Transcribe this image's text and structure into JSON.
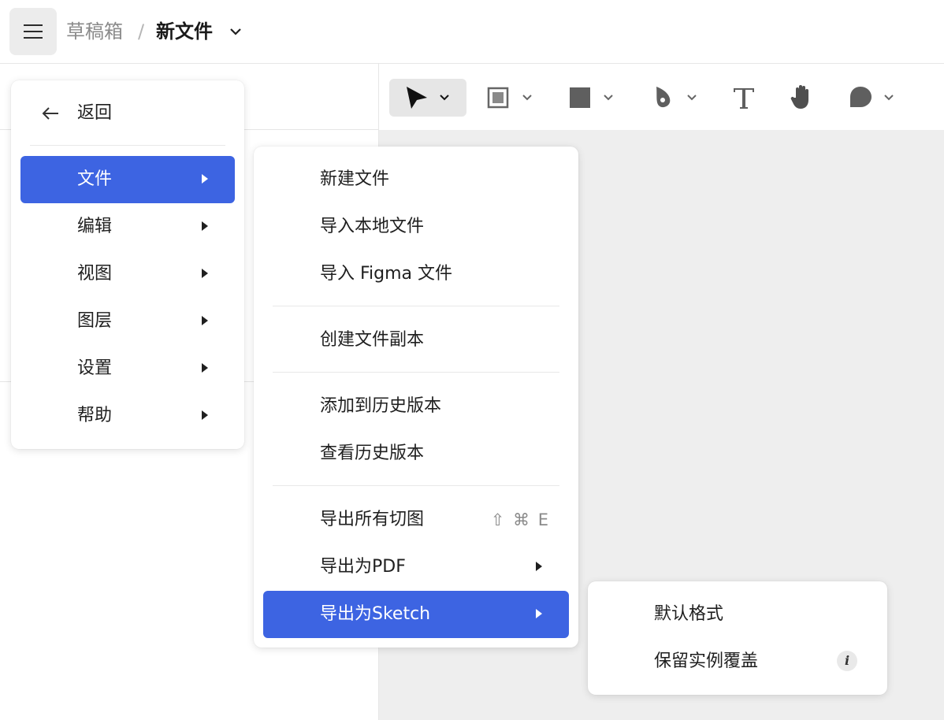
{
  "header": {
    "breadcrumb_parent": "草稿箱",
    "breadcrumb_separator": "/",
    "file_title": "新文件"
  },
  "toolbar": {
    "tools": [
      {
        "icon": "move-pointer-icon",
        "active": true,
        "has_dropdown": true
      },
      {
        "icon": "frame-icon",
        "active": false,
        "has_dropdown": true
      },
      {
        "icon": "rectangle-icon",
        "active": false,
        "has_dropdown": true
      },
      {
        "icon": "pen-icon",
        "active": false,
        "has_dropdown": true
      },
      {
        "icon": "text-icon",
        "active": false,
        "has_dropdown": false
      },
      {
        "icon": "hand-icon",
        "active": false,
        "has_dropdown": false
      },
      {
        "icon": "comment-icon",
        "active": false,
        "has_dropdown": true
      }
    ]
  },
  "main_menu": {
    "back_label": "返回",
    "items": [
      {
        "label": "文件",
        "selected": true
      },
      {
        "label": "编辑"
      },
      {
        "label": "视图"
      },
      {
        "label": "图层"
      },
      {
        "label": "设置"
      },
      {
        "label": "帮助"
      }
    ]
  },
  "file_menu": {
    "groups": [
      [
        {
          "label": "新建文件"
        },
        {
          "label": "导入本地文件"
        },
        {
          "label": "导入 Figma 文件"
        }
      ],
      [
        {
          "label": "创建文件副本"
        }
      ],
      [
        {
          "label": "添加到历史版本"
        },
        {
          "label": "查看历史版本"
        }
      ],
      [
        {
          "label": "导出所有切图",
          "shortcut": "⇧ ⌘ E"
        },
        {
          "label": "导出为PDF",
          "submenu": true
        },
        {
          "label": "导出为Sketch",
          "submenu": true,
          "selected": true
        }
      ]
    ]
  },
  "sketch_menu": {
    "items": [
      {
        "label": "默认格式"
      },
      {
        "label": "保留实例覆盖",
        "info": "i"
      }
    ]
  },
  "colors": {
    "accent": "#3d64e2",
    "canvas": "#eeeeee",
    "active_tool_bg": "#e6e6e6"
  }
}
